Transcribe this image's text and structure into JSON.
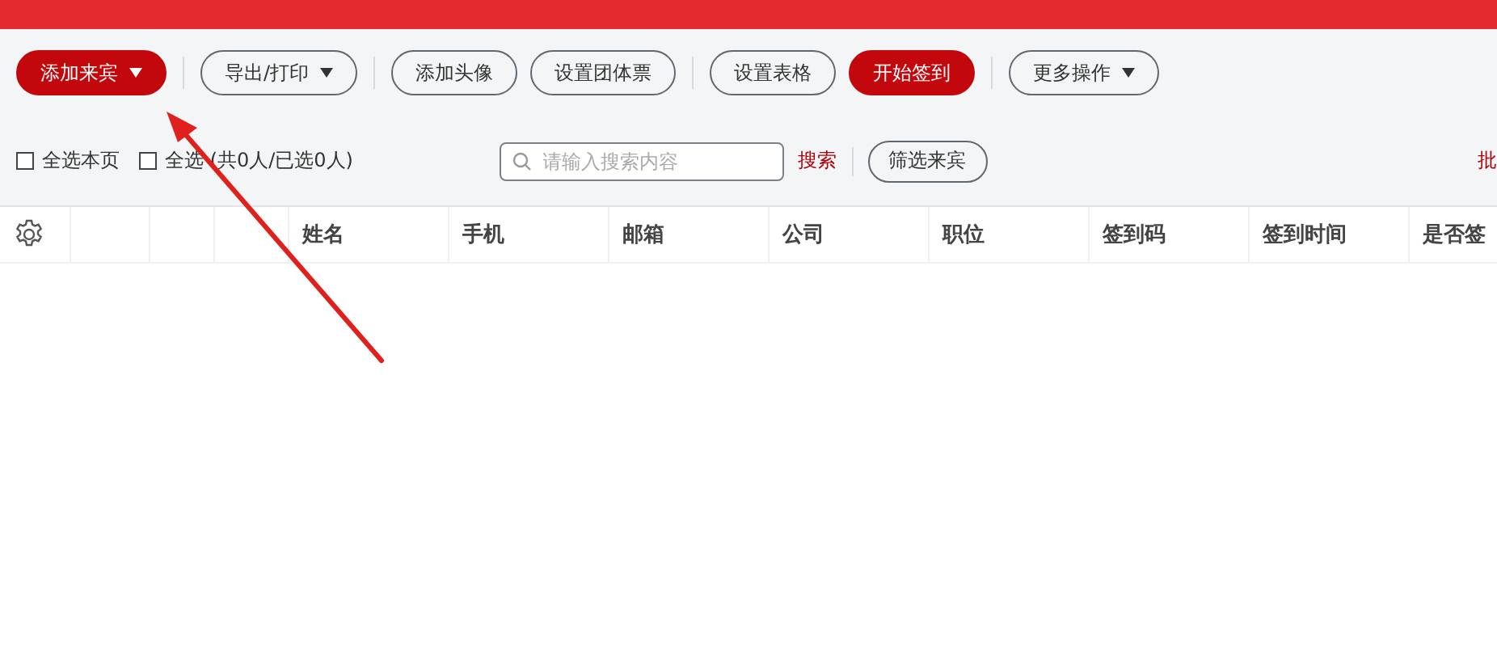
{
  "toolbar": {
    "items": [
      {
        "kind": "primary",
        "label": "添加来宾",
        "dropdown": true
      },
      {
        "kind": "divider"
      },
      {
        "kind": "outline",
        "label": "导出/打印",
        "dropdown": true
      },
      {
        "kind": "divider"
      },
      {
        "kind": "outline",
        "label": "添加头像",
        "dropdown": false
      },
      {
        "kind": "outline",
        "label": "设置团体票",
        "dropdown": false
      },
      {
        "kind": "divider"
      },
      {
        "kind": "outline",
        "label": "设置表格",
        "dropdown": false
      },
      {
        "kind": "primary",
        "label": "开始签到",
        "dropdown": false
      },
      {
        "kind": "divider"
      },
      {
        "kind": "outline",
        "label": "更多操作",
        "dropdown": true
      }
    ]
  },
  "filter_bar": {
    "checkboxes": [
      {
        "label": "全选本页",
        "checked": false
      },
      {
        "label": "全选 (共0人/已选0人)",
        "checked": false
      }
    ],
    "search": {
      "placeholder": "请输入搜索内容"
    },
    "search_link": "搜索",
    "filter_button": "筛选来宾",
    "right_link": "批"
  },
  "table": {
    "columns": [
      "",
      "",
      "",
      "",
      "姓名",
      "手机",
      "邮箱",
      "公司",
      "职位",
      "签到码",
      "签到时间",
      "是否签"
    ]
  }
}
